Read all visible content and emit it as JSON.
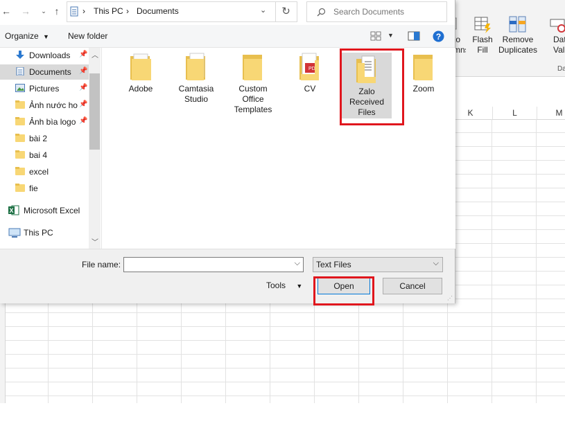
{
  "excel": {
    "ribbon_buttons": [
      {
        "label": "to\nmns"
      },
      {
        "label": "Flash\nFill"
      },
      {
        "label": "Remove\nDuplicates"
      },
      {
        "label": "Data\nValidation"
      }
    ],
    "group_fragment": "Da",
    "columns": [
      "K",
      "L",
      "M"
    ]
  },
  "dialog": {
    "breadcrumb": [
      "This PC",
      "Documents"
    ],
    "search_placeholder": "Search Documents",
    "organize_label": "Organize",
    "new_folder_label": "New folder",
    "nav_items": [
      {
        "label": "Downloads",
        "pinned": true,
        "icon": "download-icon",
        "selected": false
      },
      {
        "label": "Documents",
        "pinned": true,
        "icon": "documents-icon",
        "selected": true
      },
      {
        "label": "Pictures",
        "pinned": true,
        "icon": "pictures-icon",
        "selected": false
      },
      {
        "label": "Ảnh nước ho",
        "pinned": true,
        "icon": "folder-icon",
        "selected": false
      },
      {
        "label": "Ảnh bìa logo",
        "pinned": true,
        "icon": "folder-icon",
        "selected": false
      },
      {
        "label": "bài 2",
        "pinned": false,
        "icon": "folder-icon",
        "selected": false
      },
      {
        "label": "bai 4",
        "pinned": false,
        "icon": "folder-icon",
        "selected": false
      },
      {
        "label": "excel",
        "pinned": false,
        "icon": "folder-icon",
        "selected": false
      },
      {
        "label": "fie",
        "pinned": false,
        "icon": "folder-icon",
        "selected": false
      }
    ],
    "nav_apps": [
      {
        "label": "Microsoft Excel",
        "icon": "excel-icon"
      },
      {
        "label": "This PC",
        "icon": "computer-icon"
      }
    ],
    "folders": [
      {
        "label": "Adobe",
        "selected": false
      },
      {
        "label": "Camtasia\nStudio",
        "selected": false
      },
      {
        "label": "Custom\nOffice\nTemplates",
        "selected": false
      },
      {
        "label": "CV",
        "selected": false
      },
      {
        "label": "Zalo\nReceived\nFiles",
        "selected": true
      },
      {
        "label": "Zoom",
        "selected": false
      }
    ],
    "file_name_label": "File name:",
    "file_name_value": "",
    "file_type_value": "Text Files",
    "tools_label": "Tools",
    "open_label": "Open",
    "cancel_label": "Cancel",
    "colors": {
      "highlight": "#e0161d",
      "folder": "#f8d775",
      "selection": "#d9d9d9"
    }
  }
}
